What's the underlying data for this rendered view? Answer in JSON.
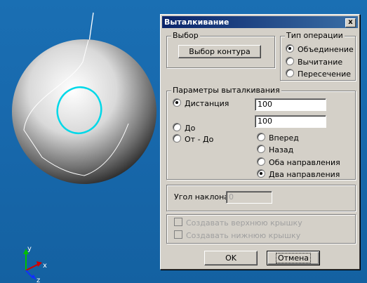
{
  "dialog": {
    "title": "Выталкивание",
    "close_label": "x",
    "selection_group": {
      "label": "Выбор",
      "button_label": "Выбор контура"
    },
    "operation_group": {
      "label": "Тип операции",
      "options": [
        {
          "label": "Объединение",
          "checked": true
        },
        {
          "label": "Вычитание",
          "checked": false
        },
        {
          "label": "Пересечение",
          "checked": false
        }
      ]
    },
    "params_group": {
      "label": "Параметры выталкивания",
      "mode_options": [
        {
          "label": "Дистанция",
          "checked": true
        },
        {
          "label": "До",
          "checked": false
        },
        {
          "label": "От - До",
          "checked": false
        }
      ],
      "distance1": "100",
      "distance2": "100",
      "direction_options": [
        {
          "label": "Вперед",
          "checked": false
        },
        {
          "label": "Назад",
          "checked": false
        },
        {
          "label": "Оба направления",
          "checked": false
        },
        {
          "label": "Два направления",
          "checked": true
        }
      ]
    },
    "angle": {
      "label": "Угол наклона:",
      "value": "0"
    },
    "caps": {
      "top_label": "Создавать верхнюю крышку",
      "bottom_label": "Создавать нижнюю крышку"
    },
    "ok_label": "OK",
    "cancel_label": "Отмена"
  },
  "axes": {
    "y_label": "y",
    "x_label": "x",
    "z_label": "z"
  },
  "colors": {
    "viewport_bg": "#1a6fb3",
    "contour": "#00d8e8",
    "dialog_bg": "#d4d0c8",
    "title_bar": "#0a246a"
  }
}
